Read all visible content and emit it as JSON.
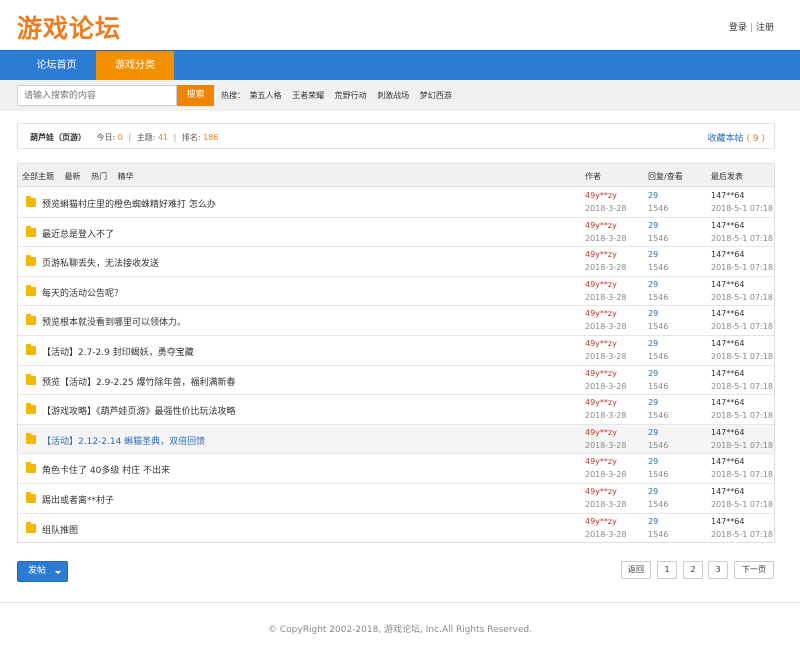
{
  "header": {
    "logo": "游戏论坛",
    "login": "登录",
    "separator": "|",
    "register": "注册"
  },
  "nav": {
    "items": [
      "论坛首页",
      "游戏分类"
    ],
    "active_color": "#f39000",
    "bar_color": "#2d7cd4"
  },
  "search": {
    "placeholder": "请输入搜索的内容",
    "button": "搜索",
    "hot_label": "热搜：",
    "hot_items": [
      "第五人格",
      "王者荣耀",
      "荒野行动",
      "刺激战场",
      "梦幻西游"
    ]
  },
  "forum": {
    "name": "葫芦娃（页游）",
    "today_label": "今日:",
    "today": "0",
    "topics_label": "主题:",
    "topics": "41",
    "rank_label": "排名:",
    "rank": "186",
    "sep": "|",
    "favorite_label": "收藏本帖",
    "favorite_count": "( 9 )"
  },
  "table": {
    "filters": [
      "全部主题",
      "最新",
      "热门",
      "精华"
    ],
    "col_author": "作者",
    "col_reply": "回复/查看",
    "col_last": "最后发表",
    "rows": [
      {
        "title": "预览蝌猫村庄里的橙色蜘蛛精好难打 怎么办",
        "author": "49y**zy",
        "adate": "2018-3-28",
        "reply": "29",
        "view": "1546",
        "last": "147**64",
        "ldate": "2018-5-1 07:18"
      },
      {
        "title": "最近总是登入不了",
        "author": "49y**zy",
        "adate": "2018-3-28",
        "reply": "29",
        "view": "1546",
        "last": "147**64",
        "ldate": "2018-5-1 07:18"
      },
      {
        "title": "页游私聊丢失，无法接收发送",
        "author": "49y**zy",
        "adate": "2018-3-28",
        "reply": "29",
        "view": "1546",
        "last": "147**64",
        "ldate": "2018-5-1 07:18"
      },
      {
        "title": "每天的活动公告呢？",
        "author": "49y**zy",
        "adate": "2018-3-28",
        "reply": "29",
        "view": "1546",
        "last": "147**64",
        "ldate": "2018-5-1 07:18"
      },
      {
        "title": "预览根本就没看到哪里可以领体力。",
        "author": "49y**zy",
        "adate": "2018-3-28",
        "reply": "29",
        "view": "1546",
        "last": "147**64",
        "ldate": "2018-5-1 07:18"
      },
      {
        "title": "【活动】2.7-2.9 封印蝎妖，勇夺宝藏",
        "author": "49y**zy",
        "adate": "2018-3-28",
        "reply": "29",
        "view": "1546",
        "last": "147**64",
        "ldate": "2018-5-1 07:18"
      },
      {
        "title": "预览【活动】2.9-2.25 爆竹除年兽，福利满新春",
        "author": "49y**zy",
        "adate": "2018-3-28",
        "reply": "29",
        "view": "1546",
        "last": "147**64",
        "ldate": "2018-5-1 07:18"
      },
      {
        "title": "【游戏攻略】《葫芦娃页游》最强性价比玩法攻略",
        "author": "49y**zy",
        "adate": "2018-3-28",
        "reply": "29",
        "view": "1546",
        "last": "147**64",
        "ldate": "2018-5-1 07:18"
      },
      {
        "title": "【活动】2.12-2.14 蝌猫圣典，双倍回馈",
        "author": "49y**zy",
        "adate": "2018-3-28",
        "reply": "29",
        "view": "1546",
        "last": "147**64",
        "ldate": "2018-5-1 07:18"
      },
      {
        "title": "角色卡住了 40多级 村庄 不出来",
        "author": "49y**zy",
        "adate": "2018-3-28",
        "reply": "29",
        "view": "1546",
        "last": "147**64",
        "ldate": "2018-5-1 07:18"
      },
      {
        "title": "踢出或者离**村子",
        "author": "49y**zy",
        "adate": "2018-3-28",
        "reply": "29",
        "view": "1546",
        "last": "147**64",
        "ldate": "2018-5-1 07:18"
      },
      {
        "title": "组队推图",
        "author": "49y**zy",
        "adate": "2018-3-28",
        "reply": "29",
        "view": "1546",
        "last": "147**64",
        "ldate": "2018-5-1 07:18"
      }
    ],
    "highlight_index": 8
  },
  "actions": {
    "post_button": "发帖"
  },
  "pagination": {
    "prev": "返回",
    "pages": [
      "1",
      "2",
      "3"
    ],
    "next": "下一页"
  },
  "footer": {
    "copyright": "© CopyRight 2002-2018, 游戏论坛, Inc.All Rights Reserved."
  }
}
